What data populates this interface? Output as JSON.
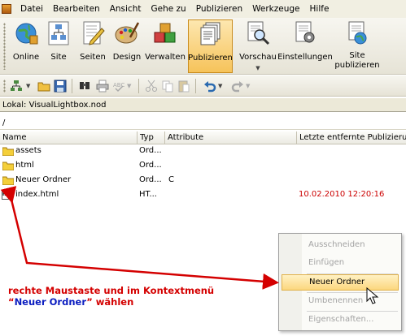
{
  "menubar": {
    "items": [
      "Datei",
      "Bearbeiten",
      "Ansicht",
      "Gehe zu",
      "Publizieren",
      "Werkzeuge",
      "Hilfe"
    ]
  },
  "toolbar": {
    "online": "Online",
    "site": "Site",
    "seiten": "Seiten",
    "design": "Design",
    "verwalten": "Verwalten",
    "publizieren": "Publizieren",
    "vorschau": "Vorschau",
    "einstellungen": "Einstellungen",
    "site_publizieren_1": "Site",
    "site_publizieren_2": "publizieren"
  },
  "location": {
    "local": "Lokal: VisualLightbox.nod",
    "path": "/"
  },
  "columns": {
    "name": "Name",
    "typ": "Typ",
    "attribute": "Attribute",
    "last_publish": "Letzte entfernte Publizierun"
  },
  "files": [
    {
      "name": "assets",
      "typ": "Ord...",
      "attribute": "",
      "date": ""
    },
    {
      "name": "html",
      "typ": "Ord...",
      "attribute": "",
      "date": ""
    },
    {
      "name": "Neuer Ordner",
      "typ": "Ord...",
      "attribute": "C",
      "date": ""
    },
    {
      "name": "index.html",
      "typ": "HT...",
      "attribute": "",
      "date": "10.02.2010 12:20:16"
    }
  ],
  "context_menu": {
    "items": [
      "Ausschneiden",
      "Einfügen",
      "Neuer Ordner",
      "Umbenennen",
      "Eigenschaften..."
    ],
    "highlighted": "Neuer Ordner"
  },
  "annotation": {
    "line1": "rechte Maustaste und im Kontextmenü",
    "line2_quote_open": "“",
    "line2_term": "Neuer Ordner",
    "line2_quote_close": "”",
    "line2_rest": " wählen"
  },
  "colors": {
    "annotation_red": "#d40000",
    "annotation_blue": "#0a1cc0",
    "date_red": "#cc0000",
    "highlight": "#fcd77e"
  }
}
